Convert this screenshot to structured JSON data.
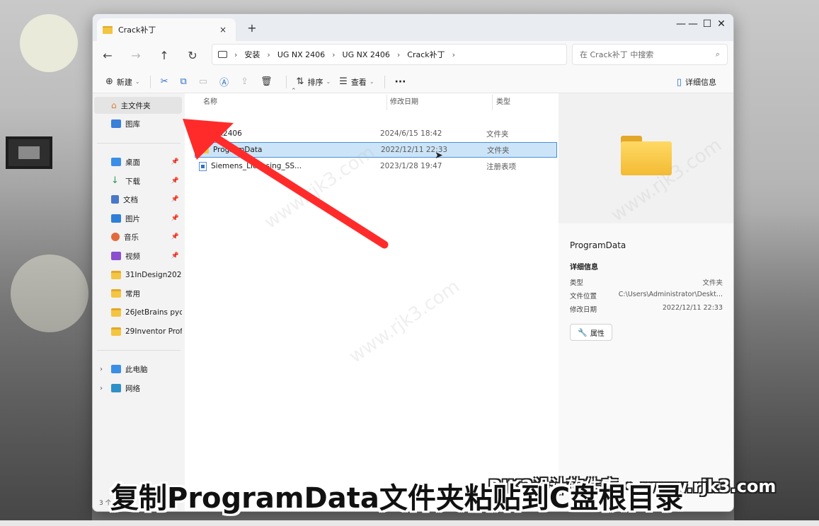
{
  "tab": {
    "title": "Crack补丁",
    "close": "×",
    "new": "+"
  },
  "window_controls": {
    "minimize": "—",
    "maximize": "☐",
    "close": "✕"
  },
  "nav": {
    "back": "←",
    "forward": "→",
    "up": "↑",
    "refresh": "↻"
  },
  "breadcrumb": [
    "安装",
    "UG NX 2406",
    "UG NX 2406",
    "Crack补丁"
  ],
  "search": {
    "placeholder": "在 Crack补丁 中搜索"
  },
  "toolbar": {
    "new_label": "新建",
    "sort_label": "排序",
    "view_label": "查看",
    "more_label": "···",
    "details_label": "详细信息"
  },
  "sidebar": {
    "home": "主文件夹",
    "gallery": "图库",
    "quick": [
      {
        "label": "桌面",
        "color": "#3a8ee6"
      },
      {
        "label": "下载",
        "color": "#2d9a5b"
      },
      {
        "label": "文档",
        "color": "#4a78c8"
      },
      {
        "label": "图片",
        "color": "#2f7fd6"
      },
      {
        "label": "音乐",
        "color": "#e26b3d"
      },
      {
        "label": "视频",
        "color": "#8a4fcf"
      }
    ],
    "folders": [
      "31InDesign2025",
      "常用",
      "26JetBrains pycha",
      "29Inventor Profes"
    ],
    "this_pc": "此电脑",
    "network": "网络"
  },
  "columns": {
    "name": "名称",
    "date": "修改日期",
    "type": "类型"
  },
  "files": [
    {
      "name": "NX2406",
      "date": "2024/6/15 18:42",
      "type": "文件夹",
      "icon": "folder-icon"
    },
    {
      "name": "ProgramData",
      "date": "2022/12/11 22:33",
      "type": "文件夹",
      "icon": "folder-icon"
    },
    {
      "name": "Siemens_Licensing_SS...",
      "date": "2023/1/28 19:47",
      "type": "注册表项",
      "icon": "registry-icon"
    }
  ],
  "preview": {
    "name": "ProgramData",
    "section": "详细信息",
    "rows": [
      {
        "k": "类型",
        "v": "文件夹"
      },
      {
        "k": "文件位置",
        "v": "C:\\Users\\Administrator\\Deskt..."
      },
      {
        "k": "修改日期",
        "v": "2022/12/11 22:33"
      }
    ],
    "properties_label": "属性"
  },
  "status": {
    "items": "3 个"
  },
  "overlay": {
    "caption": "复制ProgramData文件夹粘贴到C盘根目录",
    "brand": "RJK3设计软件库 • www.rjk3.com",
    "watermark": "www.rjk3.com"
  },
  "colors": {
    "arrow": "#ff2b2b",
    "selection": "#cce4f7",
    "accent": "#4a90d9"
  }
}
